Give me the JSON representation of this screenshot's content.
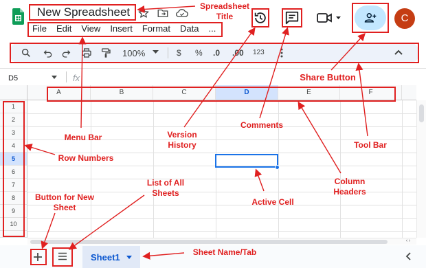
{
  "header": {
    "title": "New Spreadsheet",
    "menu": [
      "File",
      "Edit",
      "View",
      "Insert",
      "Format",
      "Data",
      "..."
    ],
    "avatar_letter": "C",
    "avatar_color": "#c53d13",
    "share_color": "#c2e7ff"
  },
  "toolbar": {
    "zoom": "100%",
    "currency": "$",
    "percent": "%",
    "dec_decrease": ".0",
    "dec_increase": ".00",
    "number_format": "123"
  },
  "formula_bar": {
    "cell_ref": "D5",
    "fx_symbol": "fx"
  },
  "columns": [
    "A",
    "B",
    "C",
    "D",
    "E",
    "F"
  ],
  "rows": [
    "1",
    "2",
    "3",
    "4",
    "5",
    "6",
    "7",
    "8",
    "9",
    "10"
  ],
  "active_cell": {
    "column": "D",
    "row": "5"
  },
  "sheet_tab": {
    "label": "Sheet1"
  },
  "annotations": {
    "spreadsheet_title": "Spreadsheet\nTitle",
    "share_button": "Share Button",
    "menu_bar": "Menu Bar",
    "version_history": "Version\nHistory",
    "comments": "Comments",
    "tool_bar": "Tool Bar",
    "row_numbers": "Row Numbers",
    "column_headers": "Column\nHeaders",
    "active_cell": "Active Cell",
    "list_of_all_sheets": "List of All\nSheets",
    "button_new_sheet": "Button for New\nSheet",
    "sheet_name_tab": "Sheet Name/Tab"
  },
  "colors": {
    "annotation": "#e02020",
    "accent": "#1a73e8",
    "selected_header": "#d3e3fd"
  }
}
